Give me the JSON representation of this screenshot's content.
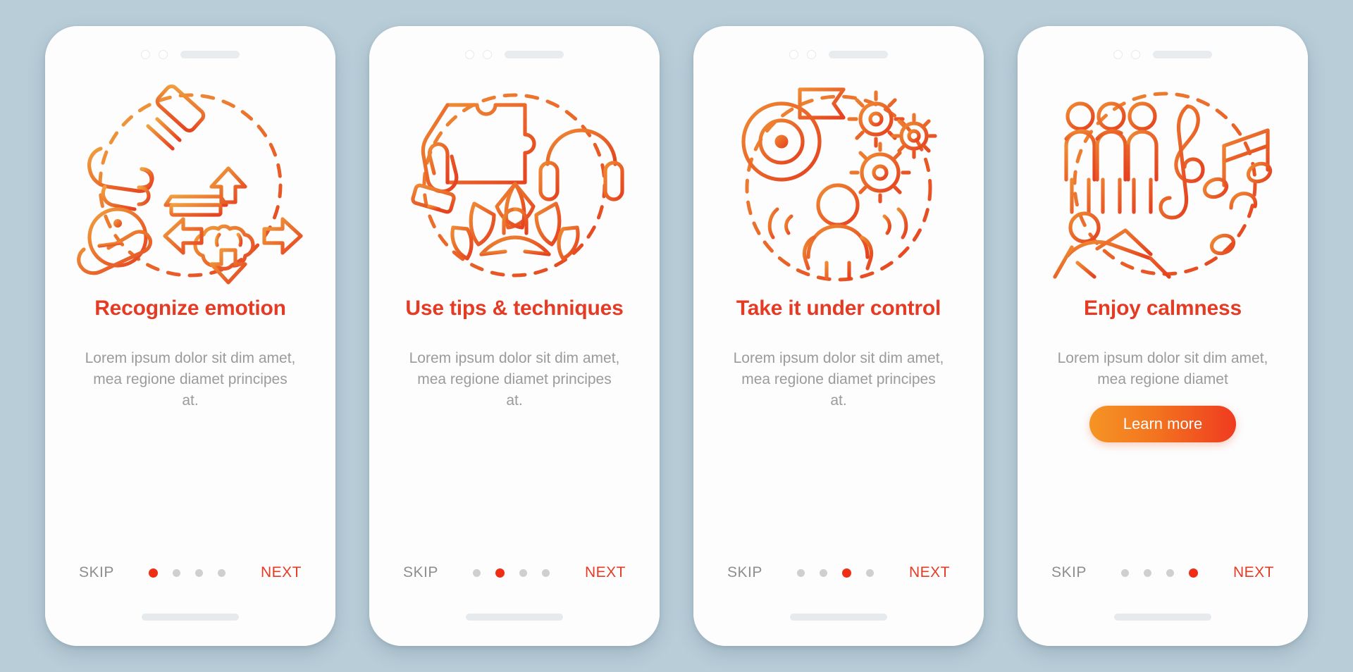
{
  "background_color": "#b8cdd8",
  "theme": {
    "title_color": "#e53b24",
    "body_color": "#9b9b9b",
    "skip_color": "#8e8e8e",
    "next_color": "#e53b24",
    "dot_color": "#cfcfcf",
    "dot_active_color": "#ef2e16",
    "cta_gradient_from": "#f59425",
    "cta_gradient_to": "#ef3b20",
    "illustration_color_from": "#ef8b33",
    "illustration_color_to": "#e5401f"
  },
  "nav_labels": {
    "skip": "SKIP",
    "next": "NEXT"
  },
  "dots_total": 4,
  "screens": [
    {
      "index": 1,
      "title": "Recognize emotion",
      "body": "Lorem ipsum dolor sit dim amet, mea regione diamet principes at.",
      "active_dot": 1,
      "cta": null,
      "icons": [
        "gavel-icon",
        "info-icon",
        "hand-icon",
        "brain-icon",
        "arrows-icon",
        "dashed-circle-icon"
      ]
    },
    {
      "index": 2,
      "title": "Use tips & techniques",
      "body": "Lorem ipsum dolor sit dim amet, mea regione diamet principes at.",
      "active_dot": 2,
      "cta": null,
      "icons": [
        "hand-puzzle-icon",
        "headphones-icon",
        "lotus-meditation-icon",
        "dashed-circle-icon"
      ]
    },
    {
      "index": 3,
      "title": "Take it under control",
      "body": "Lorem ipsum dolor sit dim amet, mea regione diamet principes at.",
      "active_dot": 3,
      "cta": null,
      "icons": [
        "target-flag-icon",
        "gears-icon",
        "person-flexing-icon",
        "dashed-circle-icon"
      ]
    },
    {
      "index": 4,
      "title": "Enjoy calmness",
      "body": "Lorem ipsum dolor sit dim amet, mea regione diamet",
      "active_dot": 4,
      "cta": "Learn more",
      "icons": [
        "people-group-icon",
        "treble-clef-icon",
        "music-notes-icon",
        "person-lounging-icon",
        "dashed-circle-icon"
      ]
    }
  ]
}
